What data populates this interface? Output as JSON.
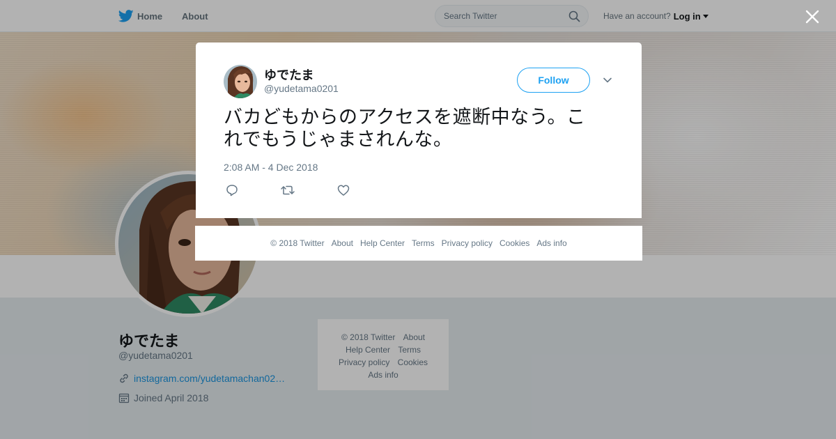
{
  "topbar": {
    "home_label": "Home",
    "about_label": "About",
    "search_placeholder": "Search Twitter",
    "have_account": "Have an account?",
    "login_label": "Log in"
  },
  "profile": {
    "name": "ゆでたま",
    "handle": "@yudetama0201",
    "link": "instagram.com/yudetamachan02…",
    "joined": "Joined April 2018"
  },
  "side_footer": {
    "rows": [
      [
        "© 2018 Twitter",
        "About"
      ],
      [
        "Help Center",
        "Terms"
      ],
      [
        "Privacy policy",
        "Cookies"
      ],
      [
        "Ads info"
      ]
    ]
  },
  "tweet": {
    "author_name": "ゆでたま",
    "author_handle": "@yudetama0201",
    "follow_label": "Follow",
    "text_line1": "バカどもからのアクセスを遮断中なう。こ",
    "text_line2": "れでもうじゃまされんな。",
    "timestamp": "2:08 AM - 4 Dec 2018"
  },
  "modal_footer": {
    "items": [
      "© 2018 Twitter",
      "About",
      "Help Center",
      "Terms",
      "Privacy policy",
      "Cookies",
      "Ads info"
    ]
  },
  "colors": {
    "accent": "#1da1f2",
    "link": "#1b95e0",
    "muted": "#657786",
    "text": "#14171a"
  }
}
